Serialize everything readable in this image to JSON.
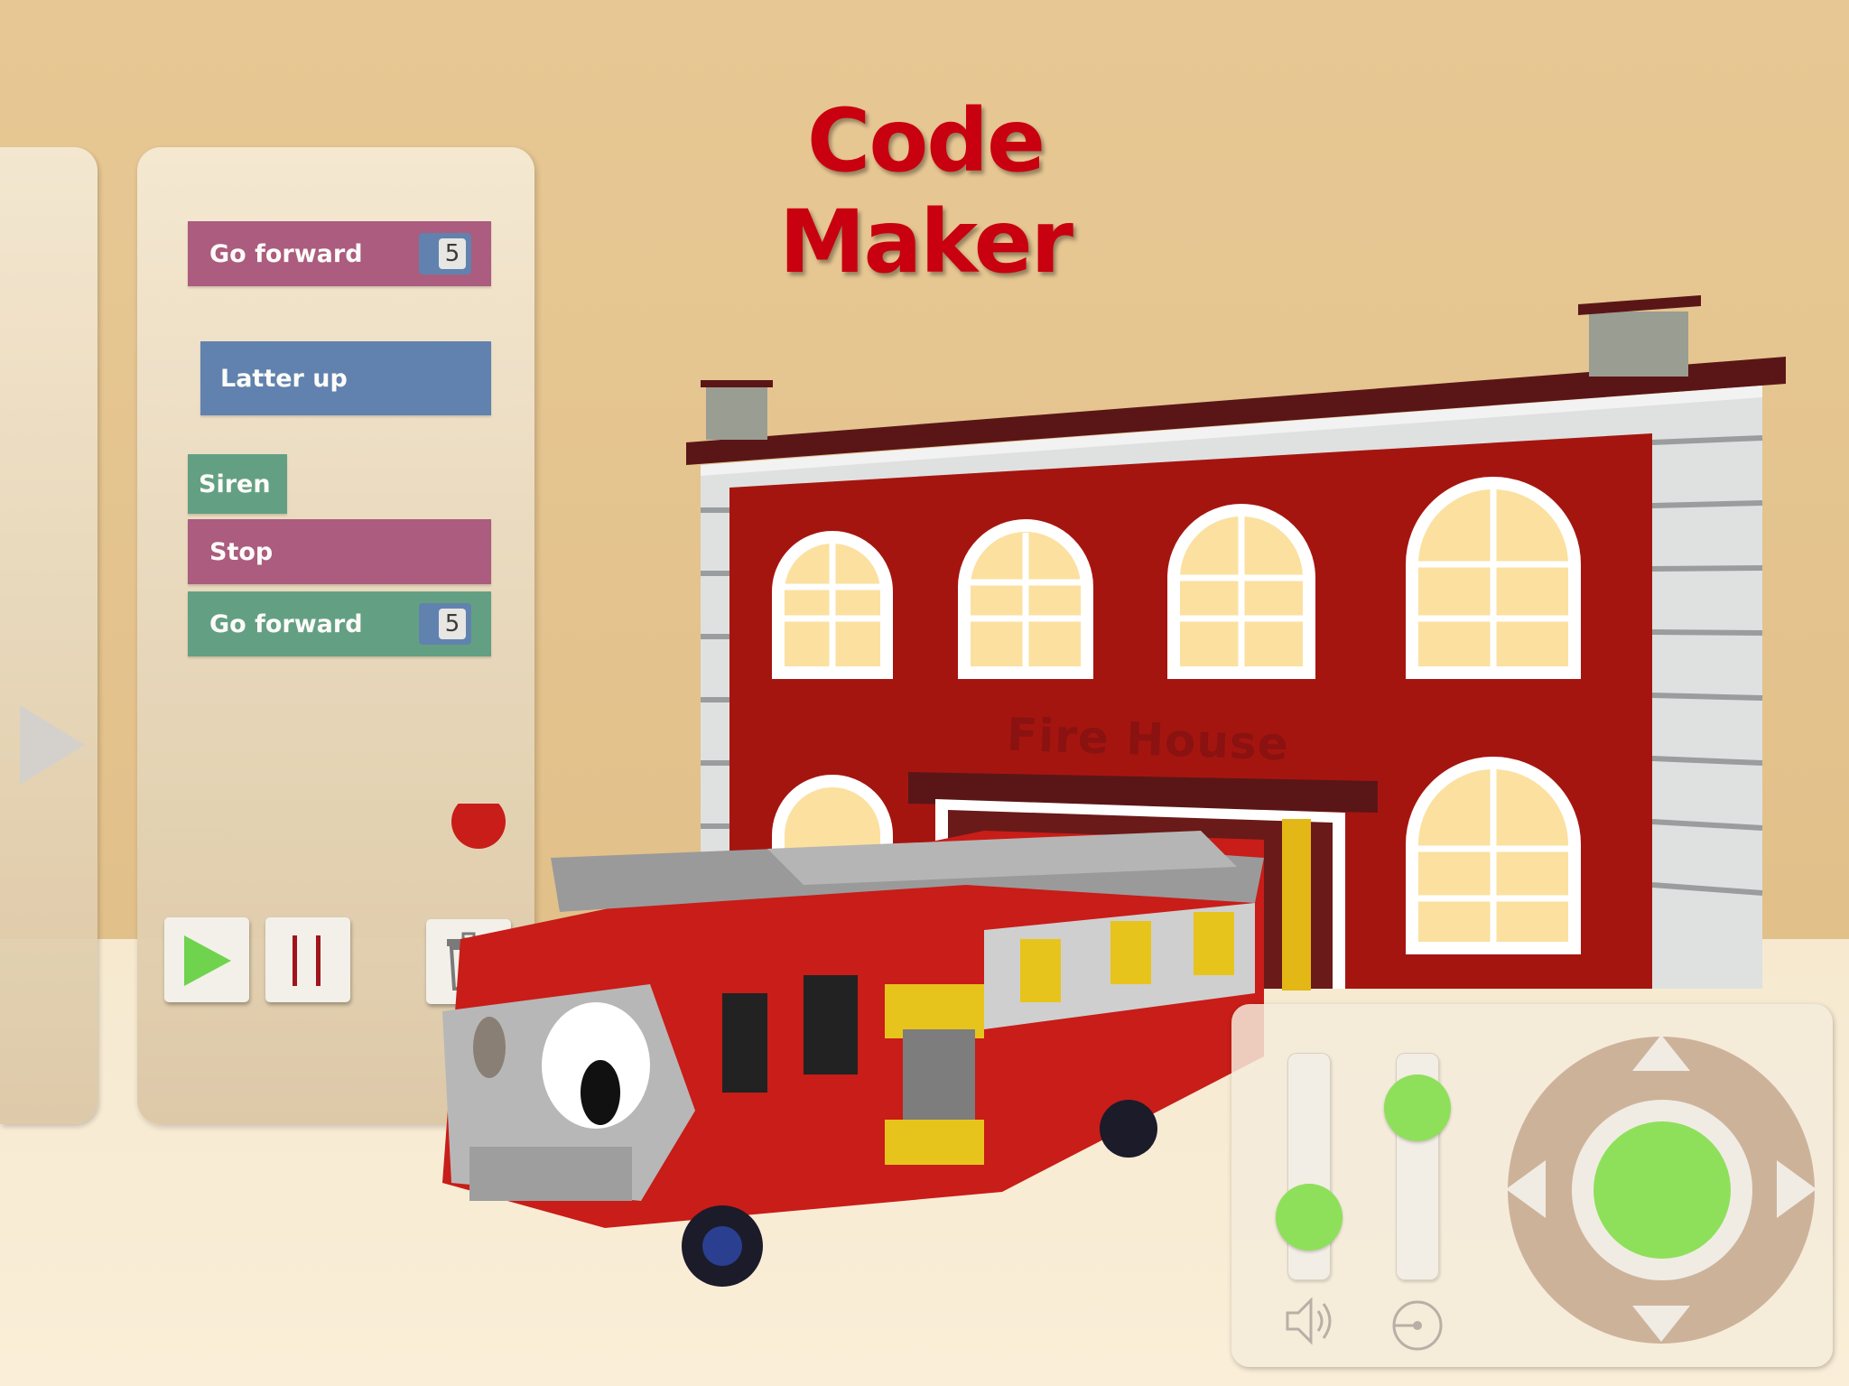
{
  "game": {
    "title": "Code Maker",
    "building_sign": "Fire House"
  },
  "code_blocks": [
    {
      "label": "Go forward",
      "color": "#a8577f",
      "value": "5"
    },
    {
      "label": "Latter up",
      "color": "#5a7fb0"
    },
    {
      "label": "Siren",
      "color": "#5d9f83"
    },
    {
      "label": "Stop",
      "color": "#a8577f"
    },
    {
      "label": "Go forward",
      "color": "#5d9f83",
      "value": "5"
    }
  ],
  "controls": {
    "play": "play-icon",
    "pause": "pause-icon",
    "delete": "trash-icon"
  },
  "remote": {
    "volume_level": 0.25,
    "speed_level": 0.85,
    "knob_color": "#8ee05a"
  },
  "colors": {
    "title": "#c9000f",
    "building_red": "#a51510",
    "wall": "#e5c690",
    "floor": "#faeed8"
  }
}
